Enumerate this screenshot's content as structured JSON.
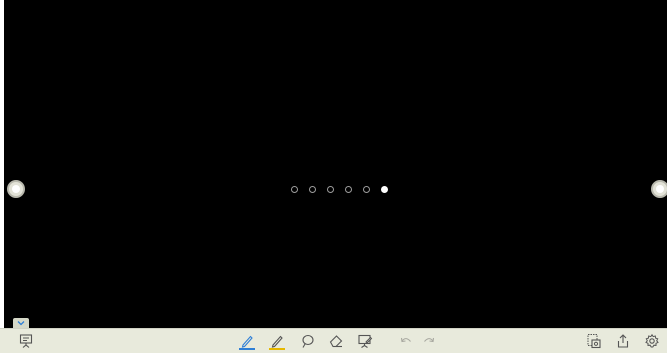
{
  "canvas": {
    "background": "#000000",
    "pagination": {
      "total_pages": 6,
      "current_page": 6
    }
  },
  "nav": {
    "prev_icon": "circle-arrow-icon",
    "next_icon": "circle-arrow-icon"
  },
  "toolbar": {
    "background": "#e8eadc",
    "pen_color": "#2f7fd6",
    "highlighter_color": "#e6b800",
    "icons": {
      "slides": "whiteboard-icon",
      "pen": "pen-icon",
      "highlighter": "highlighter-icon",
      "lasso": "lasso-icon",
      "eraser": "eraser-icon",
      "insert": "board-insert-icon",
      "undo": "undo-icon",
      "redo": "redo-icon",
      "page_manager": "page-manager-icon",
      "share": "share-icon",
      "settings": "gear-icon",
      "collapse": "chevron-down-icon"
    }
  }
}
